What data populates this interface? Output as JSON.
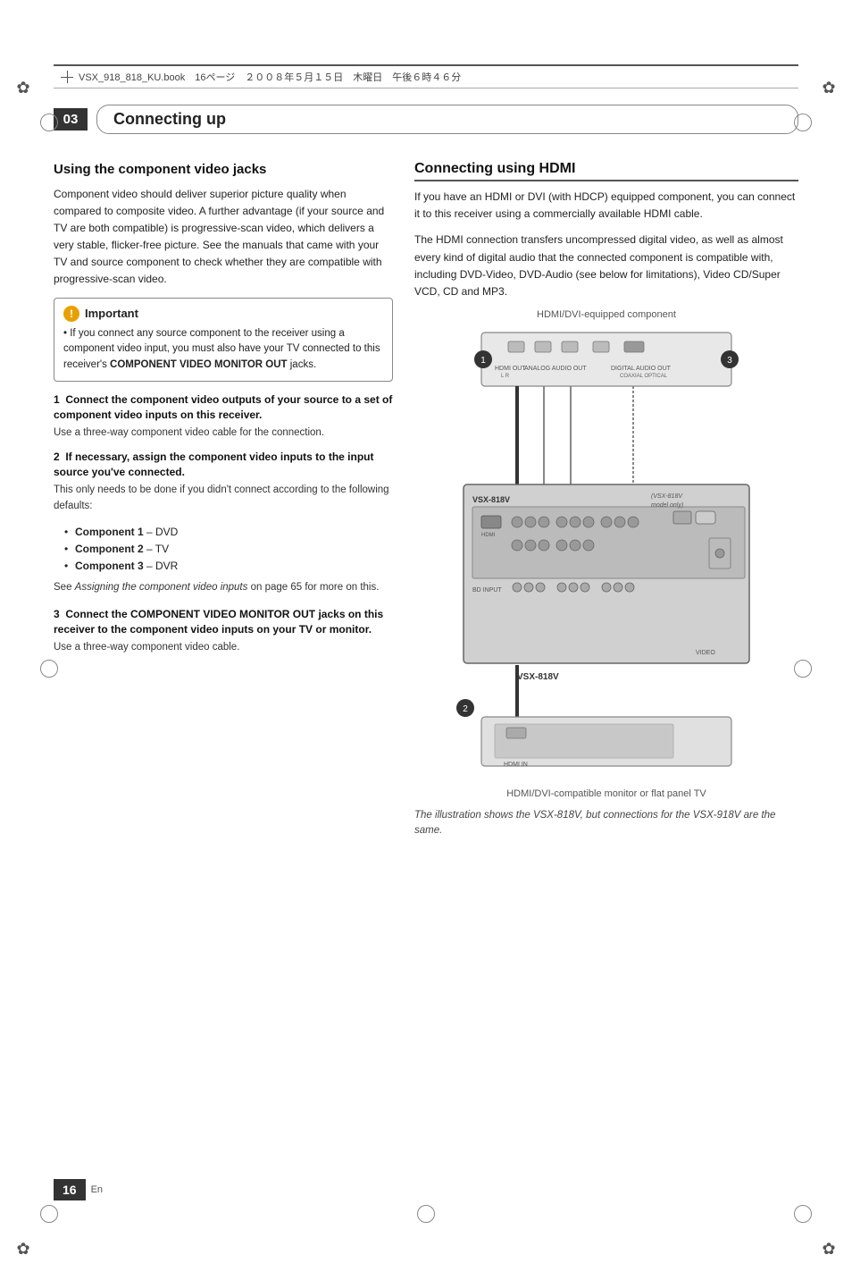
{
  "page": {
    "number": "16",
    "en_label": "En",
    "header_text": "VSX_918_818_KU.book　16ページ　２００８年５月１５日　木曜日　午後６時４６分"
  },
  "chapter": {
    "number": "03",
    "title": "Connecting up"
  },
  "left_section": {
    "title": "Using the component video jacks",
    "intro": "Component video should deliver superior picture quality when compared to composite video. A further advantage (if your source and TV are both compatible) is progressive-scan video, which delivers a very stable, flicker-free picture. See the manuals that came with your TV and source component to check whether they are compatible with progressive-scan video.",
    "important": {
      "label": "Important",
      "bullet": "If you connect any source component to the receiver using a component video input, you must also have your TV connected to this receiver's COMPONENT VIDEO MONITOR OUT jacks."
    },
    "steps": [
      {
        "number": "1",
        "heading": "Connect the component video outputs of your source to a set of component video inputs on this receiver.",
        "body": "Use a three-way component video cable for the connection."
      },
      {
        "number": "2",
        "heading": "If necessary, assign the component video inputs to the input source you've connected.",
        "body": "This only needs to be done if you didn't connect according to the following defaults:"
      }
    ],
    "defaults": [
      "Component 1 – DVD",
      "Component 2 – TV",
      "Component 3 – DVR"
    ],
    "defaults_note": "See Assigning the component video inputs on page 65 for more on this.",
    "step3": {
      "heading": "Connect the COMPONENT VIDEO MONITOR OUT jacks on this receiver to the component video inputs on your TV or monitor.",
      "body": "Use a three-way component video cable."
    }
  },
  "right_section": {
    "title": "Connecting using HDMI",
    "intro1": "If you have an HDMI or DVI (with HDCP) equipped component, you can connect it to this receiver using a commercially available HDMI cable.",
    "intro2": "The HDMI connection transfers uncompressed digital video, as well as almost every kind of digital audio that the connected component is compatible with, including DVD-Video, DVD-Audio (see below for limitations), Video CD/Super VCD, CD and MP3.",
    "diagram_label_top": "HDMI/DVI-equipped component",
    "diagram_label_receiver": "VSX-818V",
    "diagram_label_monitor": "HDMI/DVI-compatible monitor or flat panel TV",
    "model_note": "(VSX-818V model only)",
    "labels": {
      "hdmi_out": "HDMI OUT",
      "analog_audio_out": "ANALOG AUDIO OUT",
      "digital_audio_out": "DIGITAL AUDIO OUT",
      "coaxial": "COAXIAL",
      "optical": "OPTICAL",
      "hdmi_in": "HDMI IN"
    },
    "callouts": [
      "1",
      "2",
      "3"
    ],
    "caption": "The illustration shows the VSX-818V, but connections for the VSX-918V are the same."
  }
}
